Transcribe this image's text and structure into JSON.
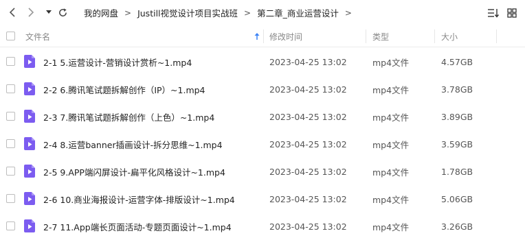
{
  "toolbar": {
    "back_icon": "chevron-left-icon",
    "forward_icon": "chevron-right-icon",
    "history_icon": "caret-down-icon",
    "refresh_icon": "refresh-icon",
    "sort_icon": "sort-list-icon",
    "grid_icon": "grid-view-icon"
  },
  "breadcrumb": {
    "items": [
      "我的网盘",
      "Justill视觉设计项目实战班",
      "第二章_商业运营设计"
    ],
    "separator": ">"
  },
  "columns": {
    "name": "文件名",
    "modified": "修改时间",
    "type": "类型",
    "size": "大小"
  },
  "files": [
    {
      "name": "2-1 5.运营设计-营销设计赏析~1.mp4",
      "modified": "2023-04-25 13:02",
      "type": "mp4文件",
      "size": "4.57GB"
    },
    {
      "name": "2-2 6.腾讯笔试题拆解创作（IP）~1.mp4",
      "modified": "2023-04-25 13:02",
      "type": "mp4文件",
      "size": "3.78GB"
    },
    {
      "name": "2-3 7.腾讯笔试题拆解创作（上色）~1.mp4",
      "modified": "2023-04-25 13:02",
      "type": "mp4文件",
      "size": "3.89GB"
    },
    {
      "name": "2-4 8.运营banner插画设计-拆分思维~1.mp4",
      "modified": "2023-04-25 13:02",
      "type": "mp4文件",
      "size": "3.59GB"
    },
    {
      "name": "2-5 9.APP端闪屏设计-扁平化风格设计~1.mp4",
      "modified": "2023-04-25 13:02",
      "type": "mp4文件",
      "size": "1.78GB"
    },
    {
      "name": "2-6 10.商业海报设计-运营字体-排版设计~1.mp4",
      "modified": "2023-04-25 13:02",
      "type": "mp4文件",
      "size": "5.06GB"
    },
    {
      "name": "2-7 11.App端长页面活动-专题页面设计~1.mp4",
      "modified": "2023-04-25 13:02",
      "type": "mp4文件",
      "size": "3.26GB"
    }
  ],
  "colors": {
    "video_icon": "#7c5cf0",
    "sort_arrow": "#3b82f6"
  }
}
